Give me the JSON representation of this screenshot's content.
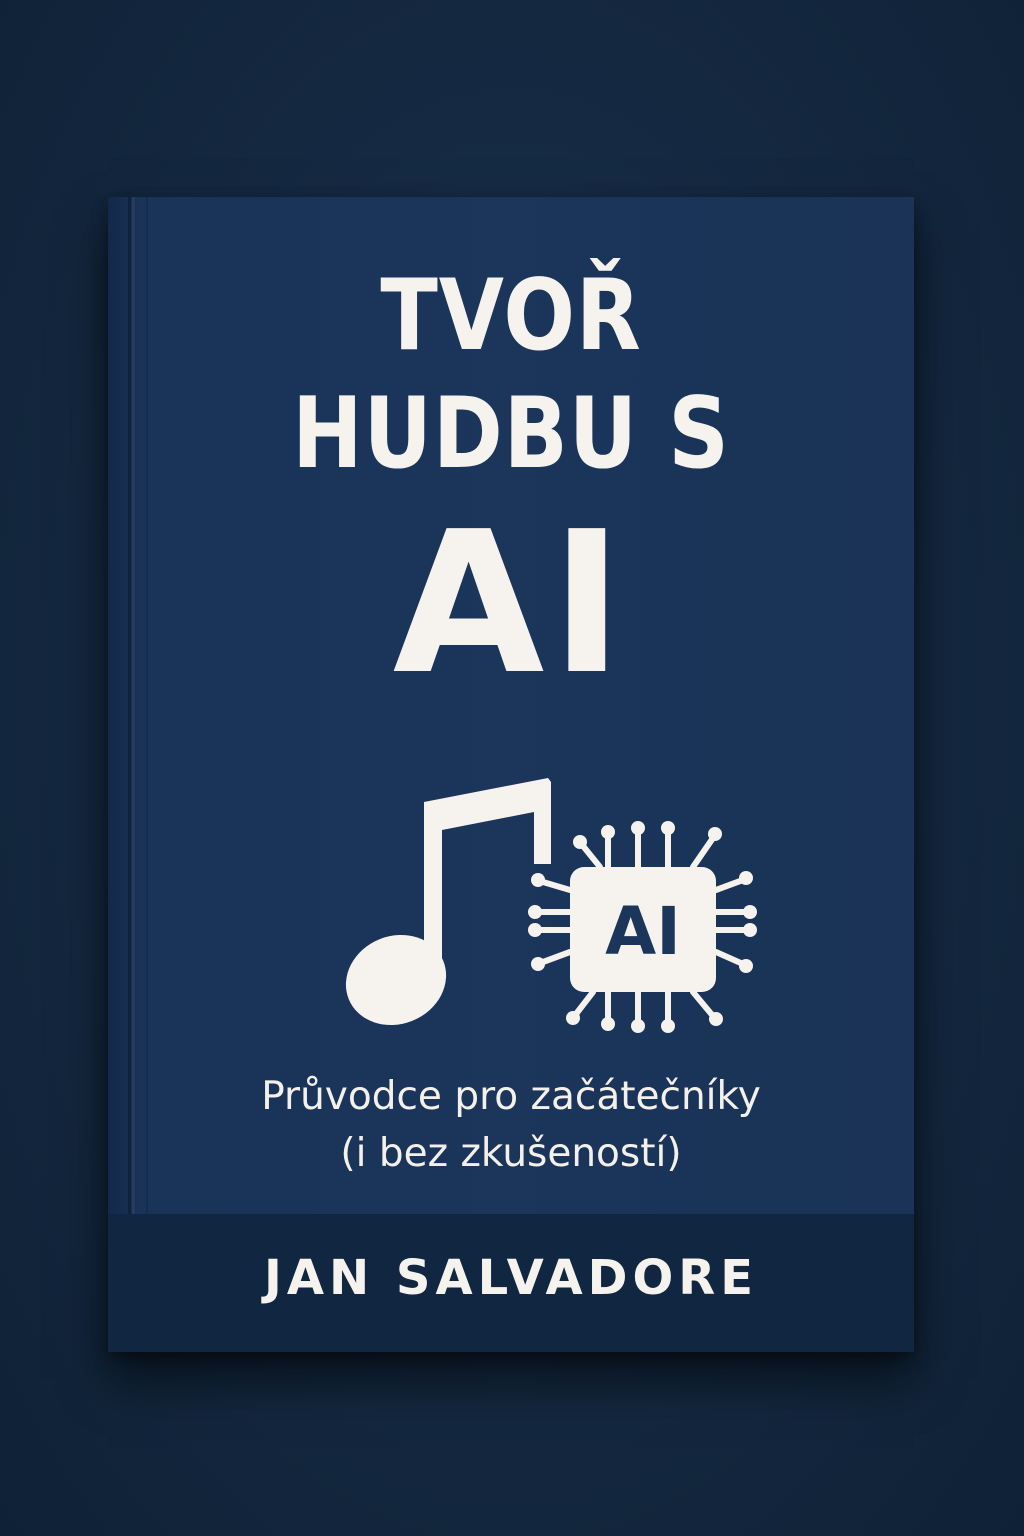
{
  "cover": {
    "title_line_1": "TVOŘ",
    "title_line_2": "HUDBU S",
    "title_line_3": "AI",
    "chip_label": "AI",
    "subtitle_line_1": "Průvodce pro začátečníky",
    "subtitle_line_2": "(i bez zkušeností)",
    "author": "JAN SALVADORE"
  },
  "icons": [
    "music-note-icon",
    "ai-chip-icon"
  ],
  "colors": {
    "background": "#142840",
    "cover": "#1b355b",
    "author_band": "#102641",
    "text": "#f6f3ee"
  }
}
